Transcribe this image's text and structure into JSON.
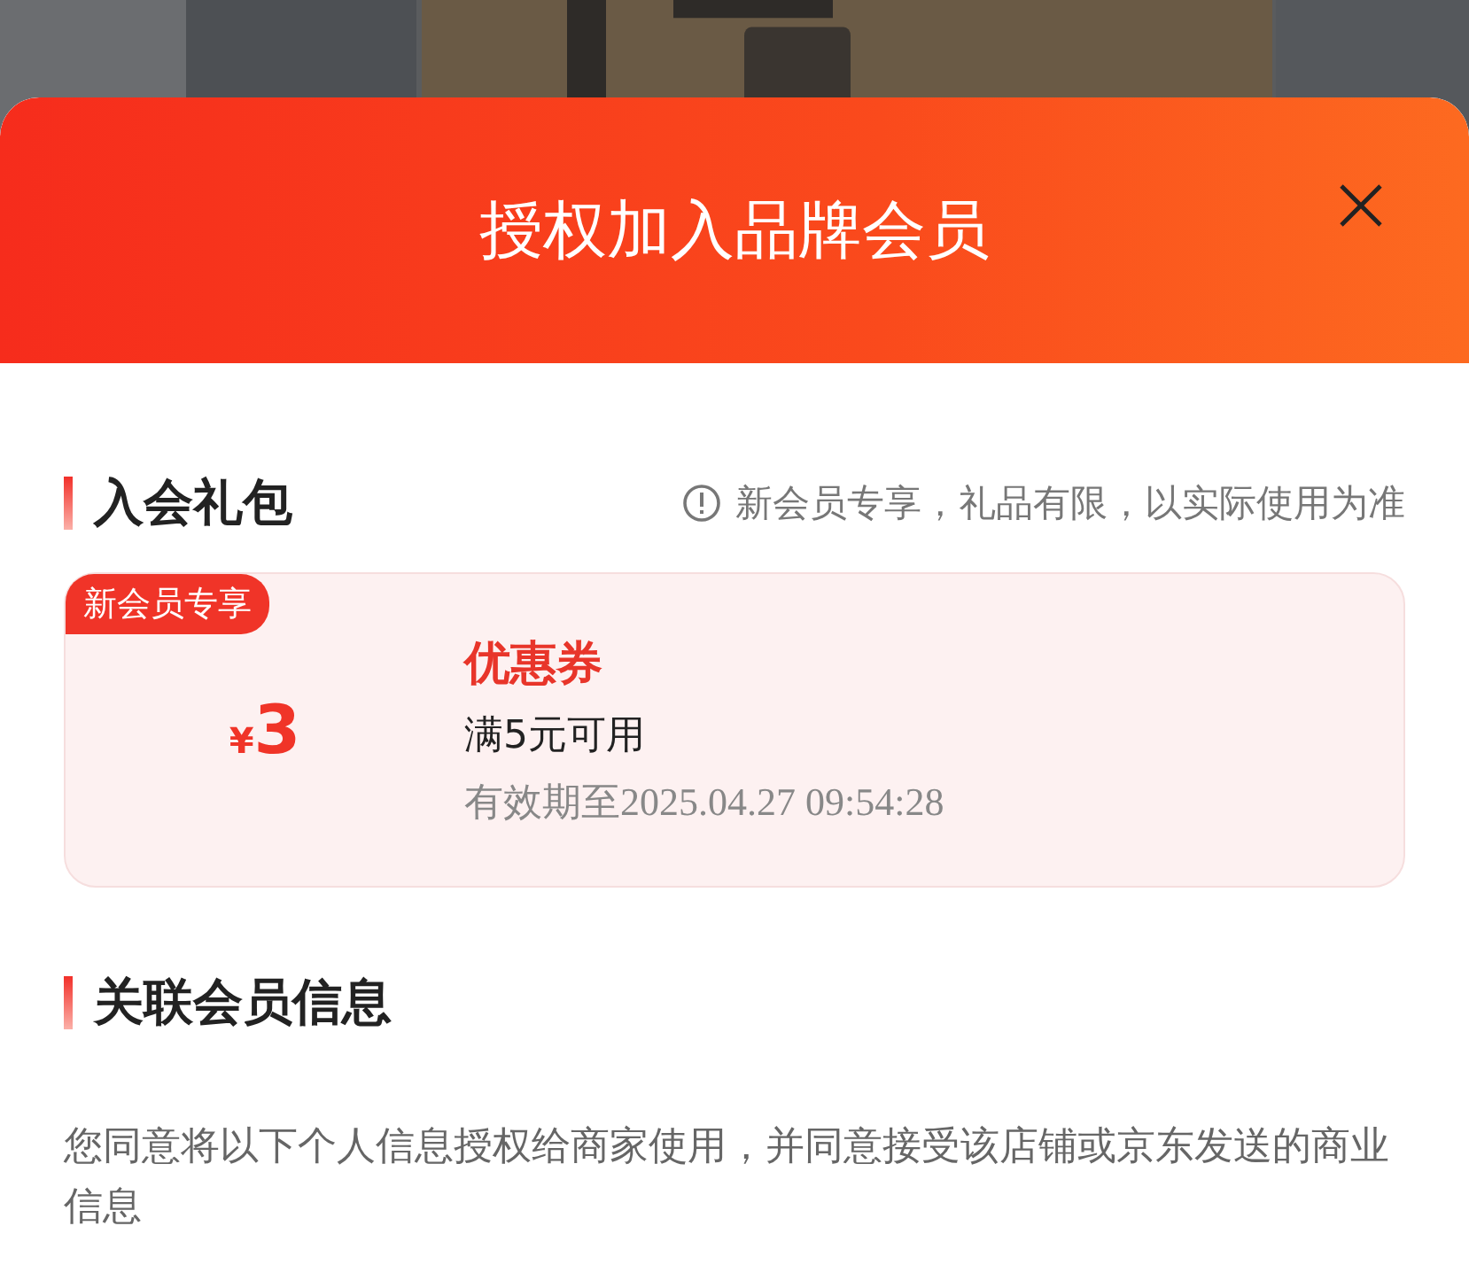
{
  "header": {
    "title": "授权加入品牌会员"
  },
  "gift_section": {
    "heading": "入会礼包",
    "notice": "新会员专享，礼品有限，以实际使用为准",
    "coupons": [
      {
        "tag": "新会员专享",
        "currency": "¥",
        "amount": "3",
        "name": "优惠券",
        "condition": "满5元可用",
        "validity": "有效期至2025.04.27 09:54:28"
      }
    ]
  },
  "info_section": {
    "heading": "关联会员信息",
    "description": "您同意将以下个人信息授权给商家使用，并同意接受该店铺或京东发送的商业信息"
  }
}
